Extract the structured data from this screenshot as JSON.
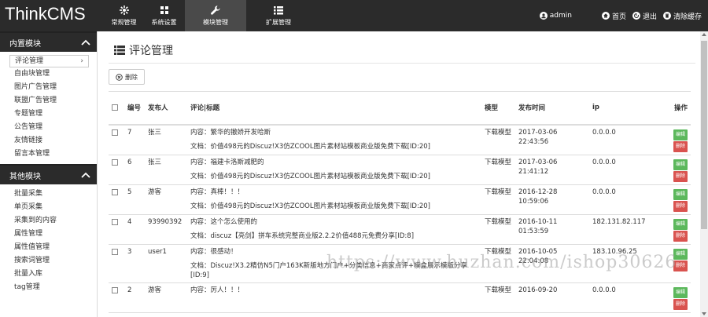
{
  "app": {
    "logo": "ThinkCMS"
  },
  "nav": [
    {
      "label": "常规管理",
      "icon": "cog-icon"
    },
    {
      "label": "系统设置",
      "icon": "grid-icon"
    },
    {
      "label": "模块管理",
      "icon": "wrench-icon",
      "active": true
    },
    {
      "label": "扩展管理",
      "icon": "list-icon"
    }
  ],
  "topright": {
    "admin": "admin",
    "home": "首页",
    "logout": "退出",
    "clear_cache": "清除缓存"
  },
  "sidebar": {
    "group1": {
      "title": "内置模块",
      "items": [
        "评论管理",
        "自由块管理",
        "图片广告管理",
        "联盟广告管理",
        "专题管理",
        "公告管理",
        "友情链接",
        "留言本管理"
      ]
    },
    "group2": {
      "title": "其他模块",
      "items": [
        "批量采集",
        "单页采集",
        "采集到的内容",
        "属性管理",
        "属性值管理",
        "搜索词管理",
        "批量入库",
        "tag管理"
      ]
    }
  },
  "page": {
    "title": "评论管理",
    "delete_label": "删除"
  },
  "table": {
    "headers": {
      "id": "编号",
      "author": "发布人",
      "content": "评论|标题",
      "model": "模型",
      "time": "发布时间",
      "ip": "ip",
      "op": "操作"
    },
    "edit_label": "编辑",
    "delete_label": "删除",
    "rows": [
      {
        "id": "7",
        "author": "张三",
        "content": "内容：繁华的撤娇开发哈斯",
        "doc": "文档：价值498元的Discuz!X3仿ZCOOL图片素材站模板商业版免费下载[ID:20]",
        "model": "下载模型",
        "date": "2017-03-06",
        "clock": "22:43:56",
        "ip": "0.0.0.0"
      },
      {
        "id": "6",
        "author": "张三",
        "content": "内容：福建卡洛斯减肥的",
        "doc": "文档：价值498元的Discuz!X3仿ZCOOL图片素材站模板商业版免费下载[ID:20]",
        "model": "下载模型",
        "date": "2017-03-06",
        "clock": "21:41:12",
        "ip": "0.0.0.0"
      },
      {
        "id": "5",
        "author": "游客",
        "content": "内容：真棒！！！",
        "doc": "文档：价值498元的Discuz!X3仿ZCOOL图片素材站模板商业版免费下载[ID:20]",
        "model": "下载模型",
        "date": "2016-12-28",
        "clock": "10:59:06",
        "ip": "0.0.0.0"
      },
      {
        "id": "4",
        "author": "93990392",
        "content": "内容：这个怎么使用的",
        "doc": "文档：discuz【亮剑】拼车系统完整商业版2.2.2价值488元免费分享[ID:8]",
        "model": "下载模型",
        "date": "2016-10-11",
        "clock": "01:53:59",
        "ip": "182.131.82.117"
      },
      {
        "id": "3",
        "author": "user1",
        "content": "内容：很感动！",
        "doc": "文档：Discuz!X3.2精仿N5门户163K新版地方门户+分类信息+商家点评+模盒展示模版分享[ID:9]",
        "model": "下载模型",
        "date": "2016-10-05",
        "clock": "22:04:08",
        "ip": "183.10.96.25"
      },
      {
        "id": "2",
        "author": "游客",
        "content": "内容：厉人！！！",
        "doc": "",
        "model": "下载模型",
        "date": "2016-09-20",
        "clock": "",
        "ip": "0.0.0.0"
      }
    ]
  },
  "watermark": "https://www.huzhan.com/ishop30626"
}
